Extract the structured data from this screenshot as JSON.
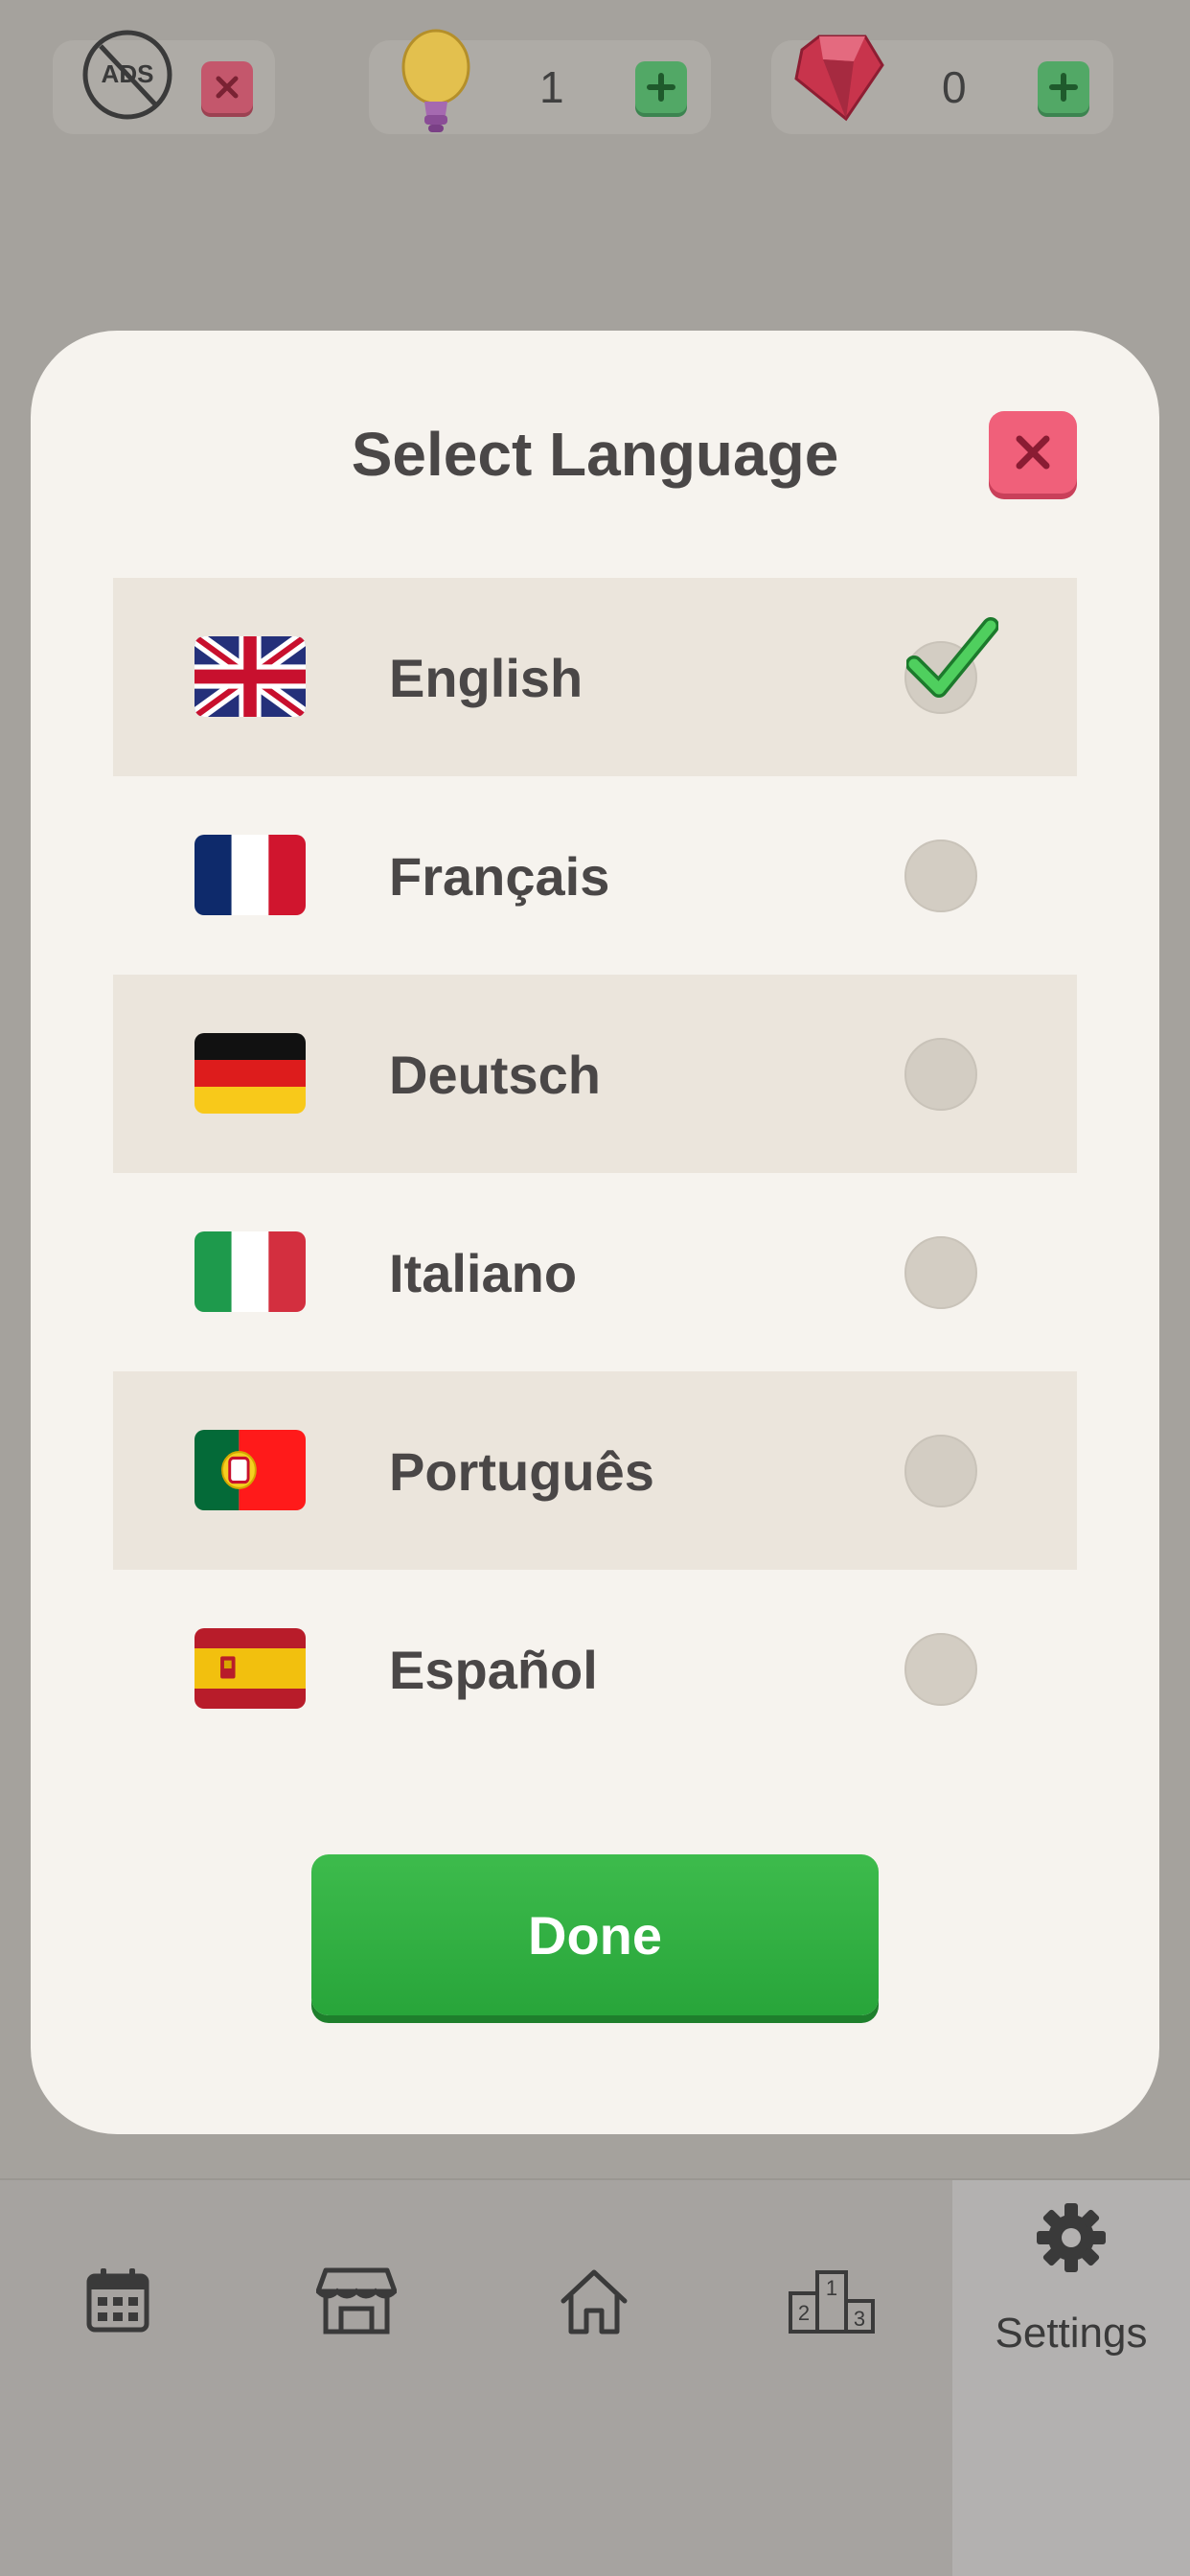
{
  "top_bar": {
    "ads_label": "ADS",
    "hints_count": "1",
    "gems_count": "0"
  },
  "dialog": {
    "title": "Select Language",
    "languages": [
      {
        "label": "English",
        "flag": "uk-flag",
        "selected": true
      },
      {
        "label": "Français",
        "flag": "france-flag",
        "selected": false
      },
      {
        "label": "Deutsch",
        "flag": "germany-flag",
        "selected": false
      },
      {
        "label": "Italiano",
        "flag": "italy-flag",
        "selected": false
      },
      {
        "label": "Português",
        "flag": "portugal-flag",
        "selected": false
      },
      {
        "label": "Español",
        "flag": "spain-flag",
        "selected": false
      }
    ],
    "done_label": "Done"
  },
  "bottom_nav": {
    "items": [
      {
        "icon": "calendar-icon"
      },
      {
        "icon": "shop-icon"
      },
      {
        "icon": "home-icon"
      },
      {
        "icon": "leaderboard-icon"
      },
      {
        "icon": "settings-icon",
        "label": "Settings",
        "active": true
      }
    ]
  },
  "colors": {
    "accent_green": "#2fae42",
    "close_red": "#f0607a",
    "overlay": "#a5a29d"
  }
}
